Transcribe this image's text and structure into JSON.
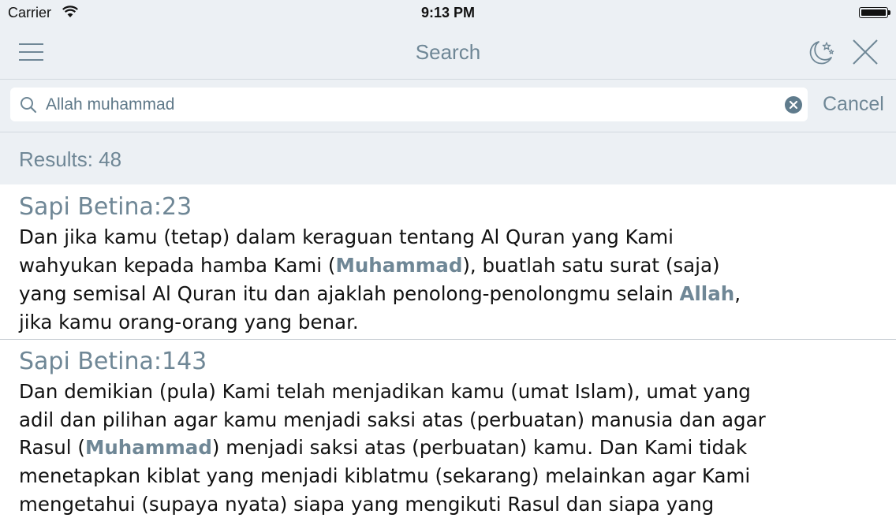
{
  "status_bar": {
    "carrier": "Carrier",
    "time": "9:13 PM"
  },
  "nav": {
    "title": "Search",
    "menu_icon": "hamburger-menu-icon",
    "night_mode_icon": "moon-stars-icon",
    "close_icon": "close-icon"
  },
  "search": {
    "value": "Allah muhammad",
    "placeholder": "",
    "cancel_label": "Cancel"
  },
  "results": {
    "count_label": "Results: 48",
    "items": [
      {
        "reference": "Sapi Betina:23",
        "lines": [
          [
            {
              "t": "Dan jika kamu (tetap) dalam keraguan tentang Al Quran yang Kami"
            }
          ],
          [
            {
              "t": "wahyukan kepada hamba Kami ("
            },
            {
              "t": "Muhammad",
              "h": true
            },
            {
              "t": "), buatlah satu surat (saja)"
            }
          ],
          [
            {
              "t": "yang semisal Al Quran itu dan ajaklah penolong-penolongmu selain "
            },
            {
              "t": "Allah",
              "h": true
            },
            {
              "t": ","
            }
          ],
          [
            {
              "t": "jika kamu orang-orang yang benar."
            }
          ]
        ]
      },
      {
        "reference": "Sapi Betina:143",
        "lines": [
          [
            {
              "t": "Dan demikian (pula) Kami telah menjadikan kamu (umat Islam), umat yang"
            }
          ],
          [
            {
              "t": "adil dan pilihan agar kamu menjadi saksi atas (perbuatan) manusia dan agar"
            }
          ],
          [
            {
              "t": "Rasul ("
            },
            {
              "t": "Muhammad",
              "h": true
            },
            {
              "t": ") menjadi saksi atas (perbuatan) kamu. Dan Kami tidak"
            }
          ],
          [
            {
              "t": "menetapkan kiblat yang menjadi kiblatmu (sekarang) melainkan agar Kami"
            }
          ],
          [
            {
              "t": "mengetahui (supaya nyata) siapa yang mengikuti Rasul dan siapa yang"
            }
          ]
        ]
      }
    ]
  },
  "colors": {
    "accent": "#6f8796",
    "bar_background": "#ecf0f4",
    "text": "#111111"
  }
}
